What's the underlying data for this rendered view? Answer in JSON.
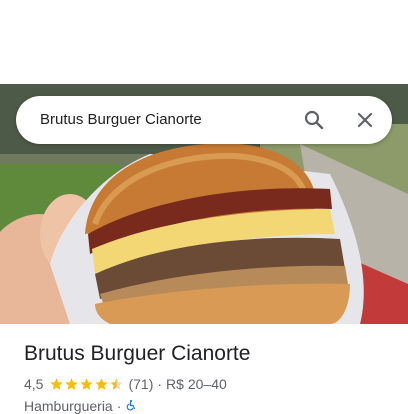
{
  "search": {
    "query": "Brutus Burguer Cianorte"
  },
  "place": {
    "name": "Brutus Burguer Cianorte",
    "rating": "4,5",
    "stars": 4.5,
    "reviews": "(71)",
    "separator": "·",
    "price": "R$ 20–40",
    "category": "Hamburgueria",
    "accessibility_icon": "wheelchair-icon"
  },
  "colors": {
    "star": "#fbbc04",
    "accessibility": "#1a73e8",
    "text_primary": "#202124",
    "text_secondary": "#5f6368"
  },
  "icons": [
    "search-icon",
    "close-icon",
    "star-icon",
    "wheelchair-icon"
  ]
}
